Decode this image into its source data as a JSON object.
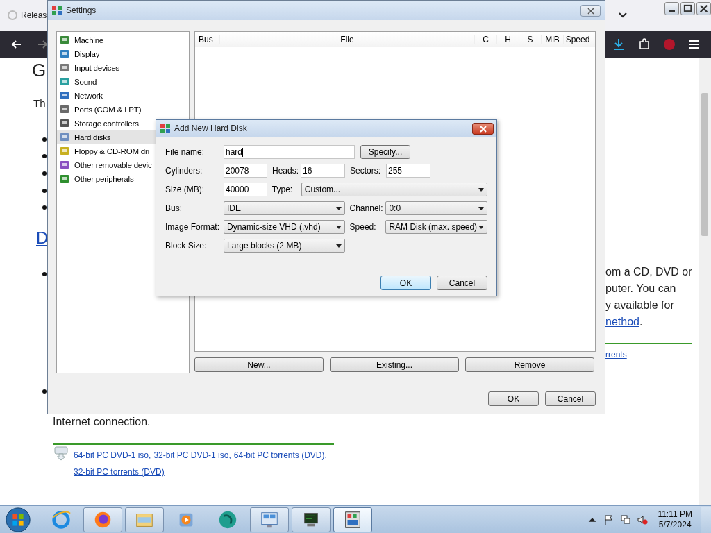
{
  "browser": {
    "tab_title": "Releas",
    "page": {
      "heading_fragment": "G",
      "text_fragment": "Th",
      "link_fragment": "D",
      "right_lines": [
        "om a CD, DVD or",
        "puter. You can",
        "y available for"
      ],
      "right_link": "nethod",
      "right_link_suffix": ".",
      "torrents_link": "rrents",
      "internet_text": "Internet connection.",
      "download_links": [
        {
          "text": "64-bit PC DVD-1 iso",
          "suffix": ","
        },
        {
          "text": "32-bit PC DVD-1 iso",
          "suffix": ","
        },
        {
          "text": "64-bit PC torrents (DVD)",
          "suffix": ","
        },
        {
          "text": "32-bit PC torrents (DVD)"
        }
      ]
    }
  },
  "settings": {
    "title": "Settings",
    "categories": [
      {
        "label": "Machine",
        "selected": false
      },
      {
        "label": "Display",
        "selected": false
      },
      {
        "label": "Input devices",
        "selected": false
      },
      {
        "label": "Sound",
        "selected": false
      },
      {
        "label": "Network",
        "selected": false
      },
      {
        "label": "Ports (COM & LPT)",
        "selected": false
      },
      {
        "label": "Storage controllers",
        "selected": false
      },
      {
        "label": "Hard disks",
        "selected": true
      },
      {
        "label": "Floppy & CD-ROM dri",
        "selected": false
      },
      {
        "label": "Other removable devic",
        "selected": false
      },
      {
        "label": "Other peripherals",
        "selected": false
      }
    ],
    "columns": [
      "Bus",
      "File",
      "C",
      "H",
      "S",
      "MiB",
      "Speed"
    ],
    "disk_buttons": [
      "New...",
      "Existing...",
      "Remove"
    ],
    "footer_buttons": [
      "OK",
      "Cancel"
    ]
  },
  "dialog": {
    "title": "Add New Hard Disk",
    "file_name": {
      "label": "File name:",
      "value": "hard"
    },
    "specify_button": "Specify...",
    "cylinders": {
      "label": "Cylinders:",
      "value": "20078"
    },
    "heads": {
      "label": "Heads:",
      "value": "16"
    },
    "sectors": {
      "label": "Sectors:",
      "value": "255"
    },
    "size": {
      "label": "Size (MB):",
      "value": "40000"
    },
    "type": {
      "label": "Type:",
      "value": "Custom..."
    },
    "bus": {
      "label": "Bus:",
      "value": "IDE"
    },
    "channel": {
      "label": "Channel:",
      "value": "0:0"
    },
    "image_format": {
      "label": "Image Format:",
      "value": "Dynamic-size VHD (.vhd)"
    },
    "speed": {
      "label": "Speed:",
      "value": "RAM Disk (max. speed)"
    },
    "block_size": {
      "label": "Block Size:",
      "value": "Large blocks (2 MB)"
    },
    "buttons": [
      "OK",
      "Cancel"
    ]
  },
  "taskbar": {
    "apps": [
      {
        "kind": "ie",
        "running": false,
        "selected": false
      },
      {
        "kind": "firefox",
        "running": true,
        "selected": false
      },
      {
        "kind": "folder",
        "running": true,
        "selected": false
      },
      {
        "kind": "media",
        "running": false,
        "selected": false
      },
      {
        "kind": "orb",
        "running": false,
        "selected": false
      },
      {
        "kind": "panel",
        "running": true,
        "selected": false
      },
      {
        "kind": "monitor",
        "running": true,
        "selected": false
      },
      {
        "kind": "emulator",
        "running": true,
        "selected": true
      }
    ],
    "time": "11:11 PM",
    "date": "5/7/2024"
  }
}
